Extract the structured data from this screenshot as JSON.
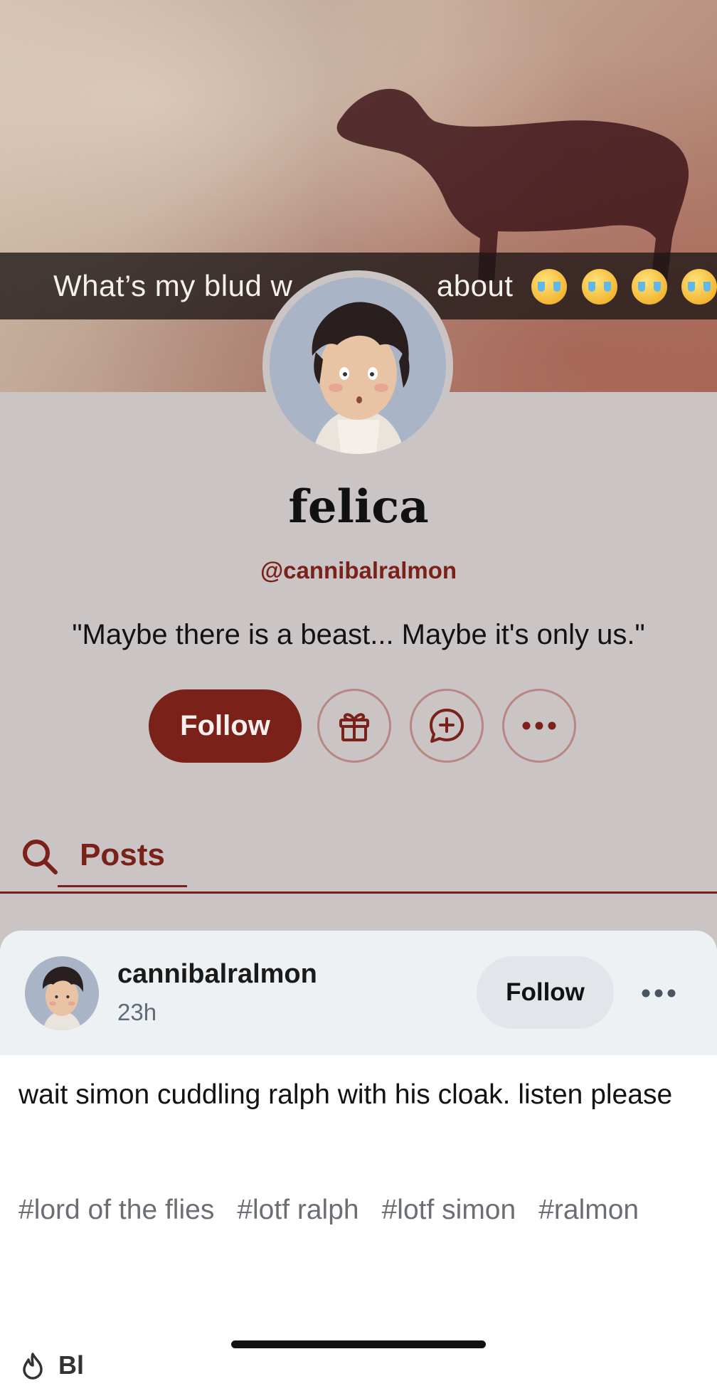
{
  "header": {
    "caption_text": "What’s my blud w",
    "caption_tail": "about",
    "emoji_icons": [
      "loudly-crying-face-icon",
      "loudly-crying-face-icon",
      "loudly-crying-face-icon",
      "loudly-crying-face-icon"
    ]
  },
  "profile": {
    "title": "felica",
    "username": "@cannibalralmon",
    "bio": "\"Maybe there is a beast... Maybe it's only us.\""
  },
  "actions": {
    "follow_label": "Follow",
    "gift_icon": "gift-icon",
    "message_icon": "message-plus-icon",
    "more_icon": "more-icon"
  },
  "tabs": {
    "search_icon": "search-icon",
    "posts_label": "Posts"
  },
  "post": {
    "author": "cannibalralmon",
    "time": "23h",
    "follow_label": "Follow",
    "body": "wait simon cuddling ralph with his cloak. listen please",
    "tags": [
      "#lord of the flies",
      "#lotf ralph",
      "#lotf simon",
      "#ralmon"
    ],
    "peek_label": "Bl"
  },
  "colors": {
    "accent": "#7a2219",
    "page_background": "#cbc4c5",
    "card_header": "#eef1f3",
    "tag_gray": "#6b6f74"
  }
}
